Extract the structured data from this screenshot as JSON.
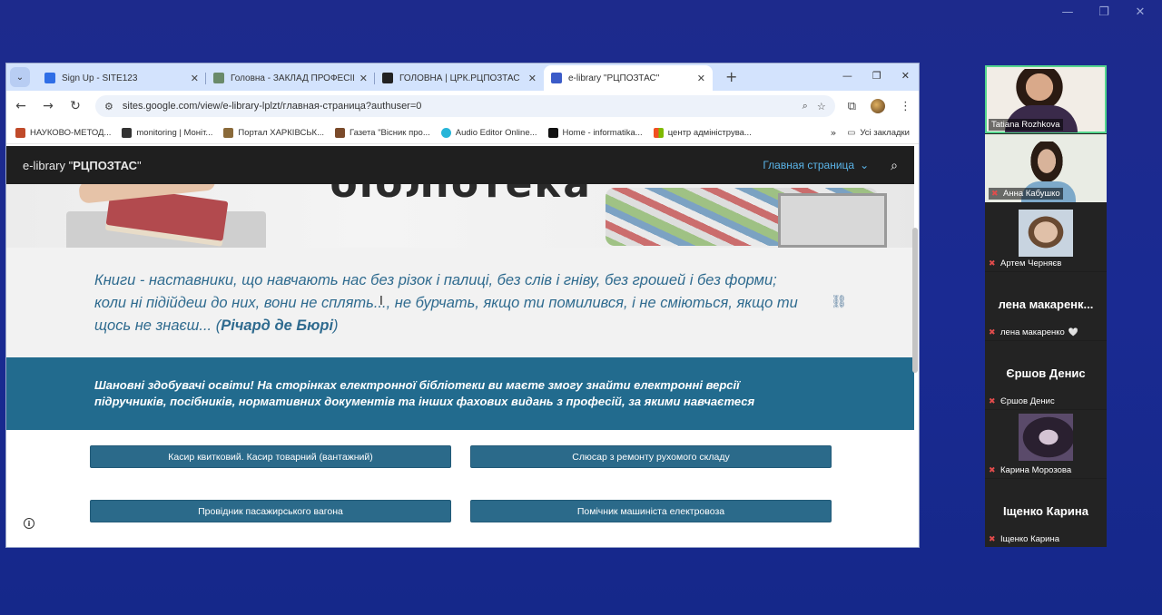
{
  "window_controls": [
    "—",
    "❐",
    "✕"
  ],
  "browser": {
    "tabs": [
      {
        "title": "Sign Up - SITE123",
        "fav_color": "#2f6ee6"
      },
      {
        "title": "Головна - ЗАКЛАД ПРОФЕСІЙ",
        "fav_color": "#6a8a6a"
      },
      {
        "title": "ГОЛОВНА | ЦРК.РЦПОЗТАС",
        "fav_color": "#222222"
      },
      {
        "title": "e-library \"РЦПОЗТАС\"",
        "fav_color": "#3b5bc8"
      }
    ],
    "url": "sites.google.com/view/e-library-lplzt/главная-страница?authuser=0",
    "bookmarks": [
      {
        "label": "НАУКОВО-МЕТОД...",
        "fav_color": "#c04a2a"
      },
      {
        "label": "monitoring | Моніт...",
        "fav_color": "#333333"
      },
      {
        "label": "Портал ХАРКІВСЬК...",
        "fav_color": "#8a6a3a"
      },
      {
        "label": "Газета \"Вісник про...",
        "fav_color": "#7a4a2a"
      },
      {
        "label": "Audio Editor Online...",
        "fav_color": "#27b5d8"
      },
      {
        "label": "Home - informatika...",
        "fav_color": "#111111"
      },
      {
        "label": "центр адмініструва...",
        "fav_color": "#f25022"
      }
    ],
    "bookmarks_all": "Усі закладки"
  },
  "site": {
    "title_prefix": "e-library \"",
    "title_bold": "РЦПОЗТАС",
    "title_suffix": "\"",
    "nav_label": "Главная страница",
    "hero_text": "бібліотека",
    "quote_text": "Книги - наставники, що навчають нас без різок і палиці, без слів і гніву, без грошей і без форми; коли ні підійдеш до них, вони не сплять..., не бурчать, якщо ти помилився, і не сміються, якщо ти щось не знаєш... (",
    "quote_author": "Річард де Бюрі",
    "quote_close": ")",
    "banner_text": "Шановні здобувачі освіти! На сторінках електронної бібліотеки ви маєте змогу знайти електронні версії підручників, посібників, нормативних документів  та інших фахових видань з  професій, за якими  навчаєтеся",
    "buttons": [
      "Касир квитковий. Касир товарний (вантажний)",
      "Слюсар з ремонту рухомого складу",
      "Провідник пасажирського вагона",
      "Помічник машиніста електровоза"
    ]
  },
  "participants": [
    {
      "name": "Tatiana Rozhkova",
      "speaking": true
    },
    {
      "name": "Анна Кабушко"
    },
    {
      "name": "Артем Черняєв"
    },
    {
      "display": "лена  макаренк...",
      "name": "лена макаренко",
      "heart": "🤍"
    },
    {
      "display": "Єршов Денис",
      "name": "Єршов Денис"
    },
    {
      "name": "Карина Морозова"
    },
    {
      "display": "Іщенко Карина",
      "name": "Іщенко Карина"
    }
  ],
  "colors": {
    "background": "#1a2a92",
    "site_header": "#1f1f1f",
    "banner": "#226b8e",
    "quote_text": "#2f6b8f",
    "button": "#2b6a8a",
    "speaking_border": "#55d68e"
  }
}
